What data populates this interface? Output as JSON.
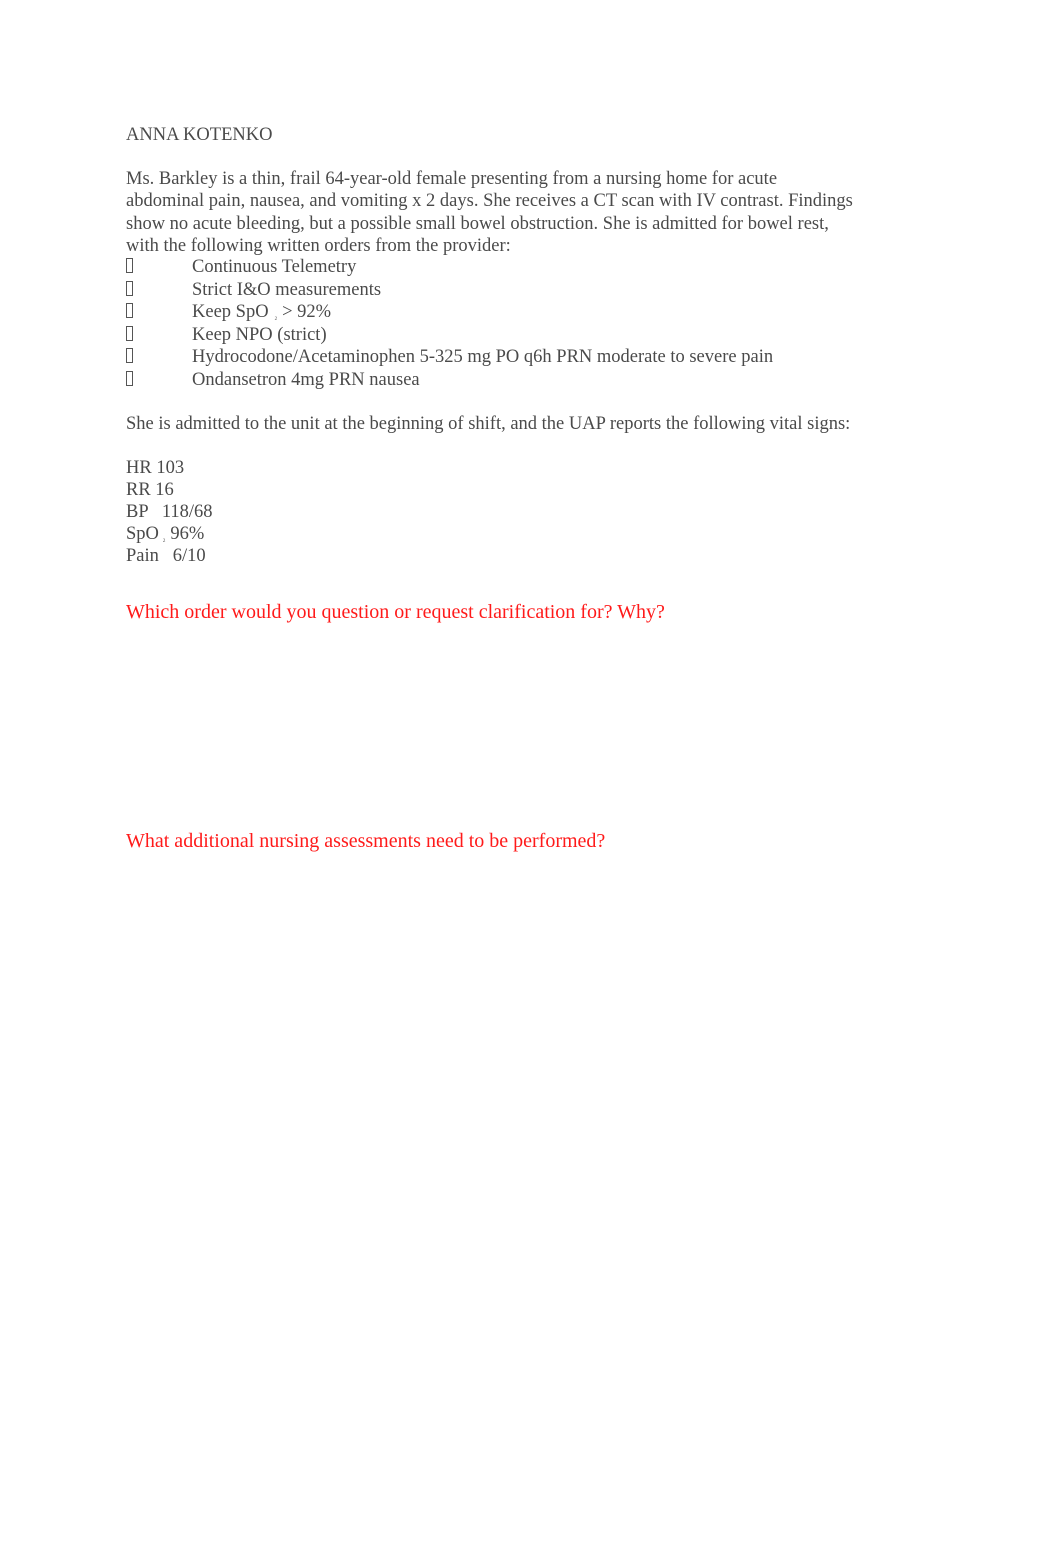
{
  "document": {
    "author": "ANNA KOTENKO",
    "intro": "Ms. Barkley is a thin, frail 64-year-old female presenting from a nursing home for acute abdominal pain, nausea, and vomiting x 2 days. She receives a CT scan with IV contrast. Findings show no acute bleeding, but a possible small bowel obstruction. She is admitted for bowel rest, with the following written orders from the provider:",
    "orders": [
      {
        "text": "Continuous Telemetry"
      },
      {
        "text": "Strict I&O measurements"
      },
      {
        "text_before": "Keep SpO",
        "subscript": "2",
        "text_after": "> 92%"
      },
      {
        "text": "Keep NPO (strict)"
      },
      {
        "text": "Hydrocodone/Acetaminophen 5-325 mg PO q6h PRN moderate to severe pain"
      },
      {
        "text": "Ondansetron 4mg PRN nausea"
      }
    ],
    "bullet_icon": "missing-glyph-box",
    "vitals_intro": "She is admitted to the unit at the beginning of shift, and the UAP reports the following vital signs:",
    "vitals": [
      {
        "label": "HR",
        "value": "103",
        "text": "HR 103"
      },
      {
        "label": "RR",
        "value": "16",
        "text": "RR 16"
      },
      {
        "label": "BP",
        "value": "118/68",
        "text": "BP   118/68"
      },
      {
        "label": "SpO",
        "subscript": "2",
        "value": "96%"
      },
      {
        "label": "Pain",
        "value": "6/10",
        "text": "Pain   6/10"
      }
    ],
    "questions": [
      {
        "text": "Which order would you question or request clarification for? Why?"
      },
      {
        "text": "What additional nursing assessments need to be performed?"
      }
    ]
  },
  "colors": {
    "body_text": "#4a4a4a",
    "question_text": "#ff1a1a",
    "background": "#ffffff"
  }
}
